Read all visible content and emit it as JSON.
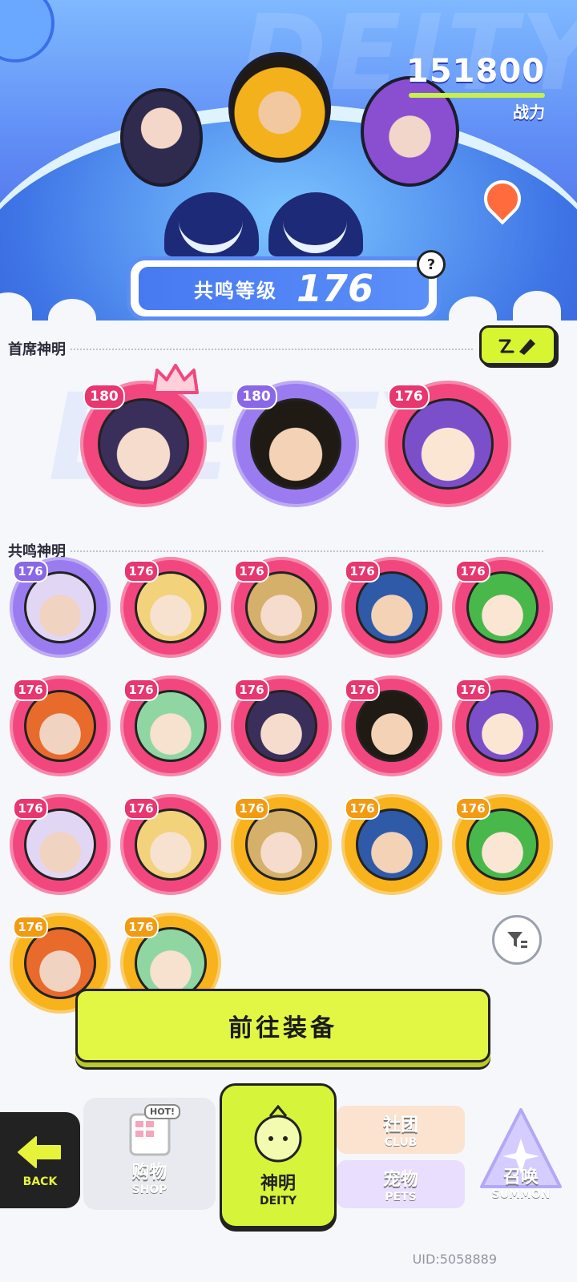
{
  "header": {
    "power_value": "151800",
    "power_label": "战力",
    "resonance_label": "共鸣等级",
    "resonance_level": "176",
    "help_icon": "?"
  },
  "sections": {
    "chief_title": "首席神明",
    "resonance_title": "共鸣神明"
  },
  "chief_deities": [
    {
      "level": "180",
      "frame": "pink",
      "crown": true
    },
    {
      "level": "180",
      "frame": "purple",
      "crown": false
    },
    {
      "level": "176",
      "frame": "pink",
      "crown": false
    }
  ],
  "resonance_deities": [
    {
      "level": "176",
      "frame": "purple"
    },
    {
      "level": "176",
      "frame": "pink"
    },
    {
      "level": "176",
      "frame": "pink"
    },
    {
      "level": "176",
      "frame": "pink"
    },
    {
      "level": "176",
      "frame": "pink"
    },
    {
      "level": "176",
      "frame": "pink"
    },
    {
      "level": "176",
      "frame": "pink"
    },
    {
      "level": "176",
      "frame": "pink"
    },
    {
      "level": "176",
      "frame": "pink"
    },
    {
      "level": "176",
      "frame": "pink"
    },
    {
      "level": "176",
      "frame": "pink"
    },
    {
      "level": "176",
      "frame": "pink"
    },
    {
      "level": "176",
      "frame": "gold"
    },
    {
      "level": "176",
      "frame": "gold"
    },
    {
      "level": "176",
      "frame": "gold"
    },
    {
      "level": "176",
      "frame": "gold"
    },
    {
      "level": "176",
      "frame": "gold"
    }
  ],
  "equip_button": "前往装备",
  "nav": {
    "back": "BACK",
    "shop_zh": "购物",
    "shop_en": "SHOP",
    "hot": "HOT!",
    "deity_zh": "神明",
    "deity_en": "DEITY",
    "club_zh": "社团",
    "club_en": "CLUB",
    "pets_zh": "宠物",
    "pets_en": "PETS",
    "summon_zh": "召唤",
    "summon_en": "SUMMON"
  },
  "uid": "UID:5058889",
  "colors": {
    "pink": "#f2477e",
    "purple": "#9a7cf0",
    "gold": "#f7b21c",
    "lime": "#d6f43a",
    "level_badge_pink": "#e8366f",
    "level_badge_purple": "#8a67e8",
    "level_badge_gold": "#f29a12"
  }
}
